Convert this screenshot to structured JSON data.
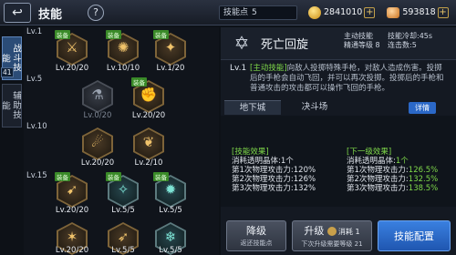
{
  "header": {
    "back_icon": "back-arrow-icon",
    "title": "技能",
    "help_label": "?"
  },
  "currency": {
    "skill_points_label": "技能点",
    "skill_points_value": "5",
    "gold": "2841010",
    "gems": "593818",
    "gold_icon": "gold-coin-icon",
    "gem_icon": "gem-icon"
  },
  "side_tabs": [
    {
      "label": "战斗技能",
      "active": true,
      "badge": "41"
    },
    {
      "label": "辅助技能",
      "active": false
    }
  ],
  "tree": {
    "levels": [
      "Lv.1",
      "Lv.5",
      "Lv.10",
      "Lv.15"
    ],
    "equipped_label": "装备",
    "skills": [
      {
        "level": "Lv.20/20",
        "icon": "sword-slash-icon",
        "equipped": true,
        "dim": false
      },
      {
        "level": "Lv.10/10",
        "icon": "claw-strike-icon",
        "equipped": true,
        "dim": false
      },
      {
        "level": "Lv.1/20",
        "icon": "blade-burst-icon",
        "equipped": true,
        "dim": false
      },
      {
        "level": "Lv.0/20",
        "icon": "potion-icon",
        "equipped": false,
        "dim": true
      },
      {
        "level": "Lv.20/20",
        "icon": "fist-icon",
        "equipped": true,
        "dim": false
      },
      {
        "level": "Lv.20/20",
        "icon": "flame-slash-icon",
        "equipped": false,
        "dim": false
      },
      {
        "level": "Lv.2/10",
        "icon": "wing-slash-icon",
        "equipped": false,
        "dim": false
      },
      {
        "level": "Lv.20/20",
        "icon": "dagger-throw-icon",
        "equipped": true,
        "dim": false
      },
      {
        "level": "Lv.5/5",
        "icon": "gun-icon",
        "equipped": true,
        "dim": false
      },
      {
        "level": "Lv.5/5",
        "icon": "spiral-icon",
        "equipped": true,
        "dim": false
      },
      {
        "level": "Lv.20/20",
        "icon": "shadow-strike-icon",
        "equipped": false,
        "dim": false
      },
      {
        "level": "Lv.5/5",
        "icon": "dash-icon",
        "equipped": false,
        "dim": false
      },
      {
        "level": "Lv.5/5",
        "icon": "ice-burst-icon",
        "equipped": false,
        "dim": false
      }
    ]
  },
  "detail": {
    "icon": "death-spin-star-icon",
    "name": "死亡回旋",
    "type_label": "主动技能",
    "cooldown_label": "技能冷却",
    "cooldown_value": "45s",
    "mastery_label": "精通等级",
    "mastery_value": "8",
    "hit_label": "连击数",
    "hit_value": "5",
    "level": "Lv.1",
    "desc_highlight": "[主动技能]",
    "desc_rest": "向敌人投掷特殊手枪，对敌人造成伤害。投掷后的手枪会自动飞回，并可以再次投掷。投掷后的手枪和普通攻击的攻击都可以操作飞回的手枪。",
    "tabs": [
      "地下城",
      "决斗场"
    ],
    "detail_button": "详情",
    "effects_current": {
      "title": "[技能效果]",
      "line1": "消耗透明晶体:1个",
      "line2": "第1次物理攻击力:120%",
      "line3": "第2次物理攻击力:126%",
      "line4": "第3次物理攻击力:132%"
    },
    "effects_next": {
      "title": "[下一级效果]",
      "line1_label": "消耗透明晶体:",
      "line1_value": "1个",
      "line2_label": "第1次物理攻击力:",
      "line2_value": "126.5%",
      "line3_label": "第2次物理攻击力:",
      "line3_value": "132.5%",
      "line4_label": "第3次物理攻击力:",
      "line4_value": "138.5%"
    }
  },
  "buttons": {
    "downgrade": "降级",
    "downgrade_sub": "返还技能点",
    "upgrade": "升级",
    "upgrade_cost": "消耗 1",
    "upgrade_sub": "下次升级需要等级 21",
    "config": "技能配置"
  }
}
